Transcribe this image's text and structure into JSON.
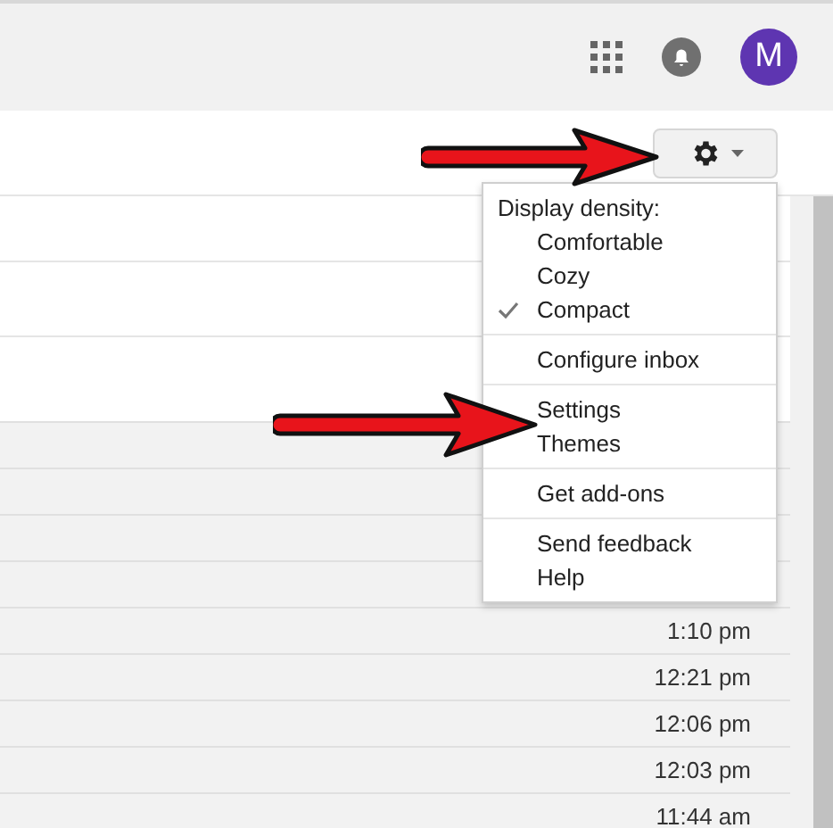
{
  "header": {
    "avatar_letter": "M"
  },
  "menu": {
    "heading": "Display density:",
    "groups": [
      [
        {
          "label": "Comfortable",
          "checked": false
        },
        {
          "label": "Cozy",
          "checked": false
        },
        {
          "label": "Compact",
          "checked": true
        }
      ],
      [
        {
          "label": "Configure inbox"
        }
      ],
      [
        {
          "label": "Settings"
        },
        {
          "label": "Themes"
        }
      ],
      [
        {
          "label": "Get add-ons"
        }
      ],
      [
        {
          "label": "Send feedback"
        },
        {
          "label": "Help"
        }
      ]
    ]
  },
  "messages": [
    {
      "time": "1:10 pm"
    },
    {
      "time": "12:21 pm"
    },
    {
      "time": "12:06 pm"
    },
    {
      "time": "12:03 pm"
    },
    {
      "time": "11:44 am"
    }
  ]
}
